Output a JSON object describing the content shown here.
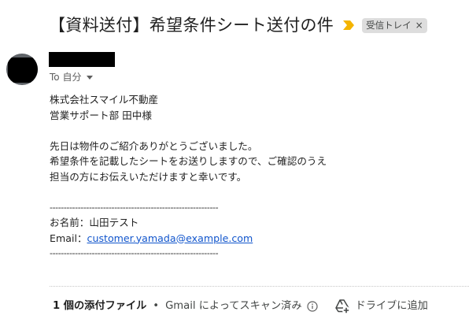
{
  "subject": {
    "title": "【資料送付】希望条件シート送付の件",
    "label_chip": "受信トレイ",
    "label_remove": "×",
    "importance_color": "#f4b400"
  },
  "sender": {
    "to_label": "To 自分"
  },
  "body": {
    "lines": [
      "株式会社スマイル不動産",
      "営業サポート部 田中様",
      "",
      "先日は物件のご紹介ありがとうございました。",
      "希望条件を記載したシートをお送りしますので、ご確認のうえ",
      "担当の方にお伝えいただけますと幸いです。",
      "",
      "------------------------------------------------------------",
      "お名前：山田テスト"
    ],
    "email_label": "Email：",
    "email_link": "customer.yamada@example.com",
    "closing_dash": "------------------------------------------------------------"
  },
  "attachments": {
    "count_label": "1 個の添付ファイル",
    "bullet": "•",
    "scan_text": "Gmail によってスキャン済み",
    "drive_button": "ドライブに追加"
  }
}
